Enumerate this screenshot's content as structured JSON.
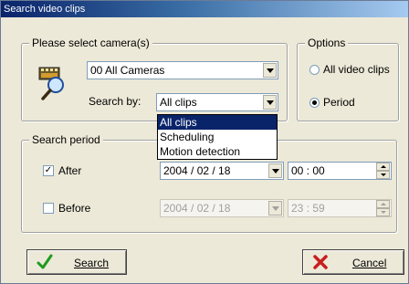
{
  "window": {
    "title": "Search video clips"
  },
  "camera_group": {
    "legend": "Please select camera(s)",
    "camera_value": "00 All Cameras",
    "search_by_label": "Search by:",
    "search_by_value": "All clips",
    "search_by_options": [
      "All clips",
      "Scheduling",
      "Motion detection"
    ],
    "search_by_highlighted": 0
  },
  "options_group": {
    "legend": "Options",
    "all_video_clips_label": "All video clips",
    "period_label": "Period",
    "selected": "period"
  },
  "period_group": {
    "legend": "Search period",
    "after": {
      "label": "After",
      "checked": true,
      "check_glyph": "✓",
      "date": "2004 / 02 / 18",
      "time": "00 : 00"
    },
    "before": {
      "label": "Before",
      "checked": false,
      "date": "2004 / 02 / 18",
      "time": "23 : 59"
    }
  },
  "buttons": {
    "search_label": "Search",
    "cancel_label": "Cancel"
  },
  "colors": {
    "title_start": "#0a246a",
    "title_end": "#a6caf0",
    "highlight": "#0a246a",
    "face": "#ece9d8"
  },
  "icons": {
    "camera_search": "camera-search-icon",
    "search": "green-checkmark-icon",
    "cancel": "red-x-icon"
  }
}
